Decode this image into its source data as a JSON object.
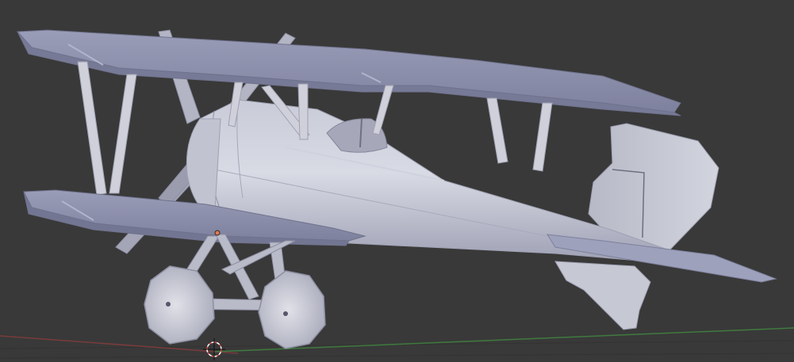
{
  "viewport": {
    "background_color": "#393939",
    "grid_color": "#2f2f2f",
    "x_axis_color": "#7a3b3b",
    "y_axis_color": "#3f7a3f",
    "object_color": "#b9bbcb",
    "object_shadow_color": "#8e90a5",
    "wing_color": "#8f92ad",
    "origin_marker_color": "#e07a52"
  },
  "scene": {
    "object_type": "biplane",
    "cursor_icon": "3d-cursor-icon"
  }
}
